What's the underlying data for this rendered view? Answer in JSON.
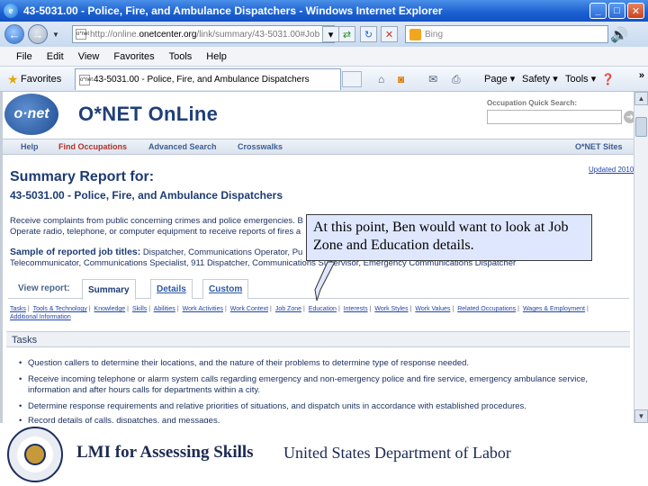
{
  "window": {
    "title": "43-5031.00 - Police, Fire, and Ambulance Dispatchers - Windows Internet Explorer",
    "controls": [
      "_",
      "□",
      "✕"
    ]
  },
  "address": {
    "url_prefix": "http://online.",
    "url_domain": "onetcenter.org",
    "url_path": "/link/summary/43-5031.00#Job",
    "favicon_text": "o*net",
    "search_placeholder": "Bing"
  },
  "menu": [
    "File",
    "Edit",
    "View",
    "Favorites",
    "Tools",
    "Help"
  ],
  "favorites_bar": {
    "favorites_label": "Favorites",
    "tab_title": "43-5031.00 - Police, Fire, and Ambulance Dispatchers",
    "commands": [
      "Page",
      "Safety",
      "Tools"
    ],
    "overflow": "»"
  },
  "onet": {
    "logo_text": "o·net",
    "site_title": "O*NET OnLine",
    "quick_search_label": "Occupation Quick Search:",
    "nav": [
      "Help",
      "Find Occupations",
      "Advanced Search",
      "Crosswalks",
      "O*NET Sites"
    ],
    "report_title": "Summary Report for:",
    "updated": "Updated 2010",
    "occupation": "43-5031.00 - Police, Fire, and Ambulance Dispatchers",
    "description_line1": "Receive complaints from public concerning crimes and police emergencies. B",
    "description_line2": "Operate radio, telephone, or computer equipment to receive reports of fires a",
    "sample_label": "Sample of reported job titles:",
    "sample_line1": " Dispatcher, Communications Operator, Pu",
    "sample_line2": "Telecommunicator, Communications Specialist, 911 Dispatcher, Communications Supervisor, Emergency Communications Dispatcher",
    "view_report_label": "View report:",
    "view_tabs": [
      "Summary",
      "Details",
      "Custom"
    ],
    "sections": [
      "Tasks",
      "Tools & Technology",
      "Knowledge",
      "Skills",
      "Abilities",
      "Work Activities",
      "Work Context",
      "Job Zone",
      "Education",
      "Interests",
      "Work Styles",
      "Work Values",
      "Related Occupations",
      "Wages & Employment",
      "Additional Information"
    ],
    "tasks_heading": "Tasks",
    "tasks": [
      "Question callers to determine their locations, and the nature of their problems to determine type of response needed.",
      "Receive incoming telephone or alarm system calls regarding emergency and non-emergency police and fire service, emergency ambulance service,",
      "information and after hours calls for departments within a city.",
      "Determine response requirements and relative priorities of situations, and dispatch units in accordance with established procedures.",
      "Record details of calls, dispatches, and messages."
    ]
  },
  "callout": {
    "text": "At this point, Ben would  want to look at Job Zone and Education details."
  },
  "footer": {
    "left": "LMI for Assessing Skills",
    "right": "United States Department of Labor"
  }
}
